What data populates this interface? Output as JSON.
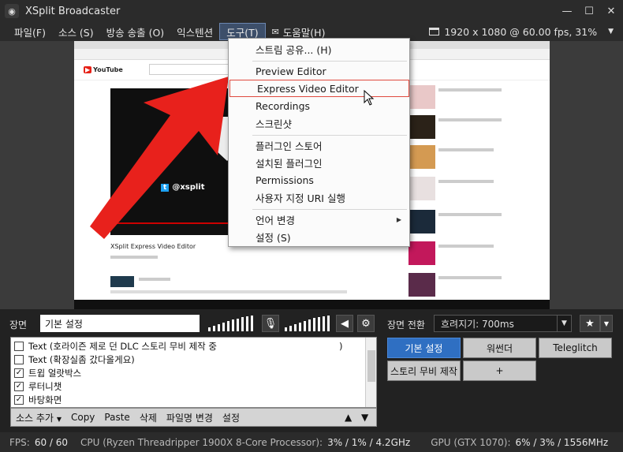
{
  "window": {
    "title": "XSplit Broadcaster",
    "icon": "broadcast-icon",
    "controls": [
      "minimize-icon",
      "maximize-icon",
      "close-icon"
    ]
  },
  "menubar": {
    "items": [
      {
        "label": "파일(F)"
      },
      {
        "label": "소스 (S)"
      },
      {
        "label": "방송 송출 (O)"
      },
      {
        "label": "익스텐션"
      },
      {
        "label": "도구(T)"
      },
      {
        "label": "도움말(H)"
      }
    ],
    "resolution": "1920 x 1080 @ 60.00 fps, 31%"
  },
  "tools_menu": {
    "items": [
      {
        "label": "스트림 공유... (H)"
      },
      {
        "label": "Preview Editor"
      },
      {
        "label": "Express Video Editor"
      },
      {
        "label": "Recordings"
      },
      {
        "label": "스크린샷"
      },
      {
        "label": "플러그인 스토어"
      },
      {
        "label": "설치된 플러그인"
      },
      {
        "label": "Permissions"
      },
      {
        "label": "사용자 지정 URI 실행"
      },
      {
        "label": "언어 변경"
      },
      {
        "label": "설정 (S)"
      }
    ],
    "highlighted": "Express Video Editor"
  },
  "preview": {
    "site": "YouTube",
    "video_handle": "@xsplit",
    "video_title": "XSplit Express Video Editor",
    "twitter_badge": "t"
  },
  "scene_panel": {
    "label": "장면",
    "current_scene": "기본 설정"
  },
  "sources": {
    "items": [
      {
        "label": "Text (호라이즌 제로 던 DLC 스토리 무비 제작 중",
        "suffix": ")",
        "checked": false
      },
      {
        "label": "Text (확장실좀 갔다올게요)",
        "checked": false
      },
      {
        "label": "트윕 얼랏박스",
        "checked": true
      },
      {
        "label": "루터니챗",
        "checked": true
      },
      {
        "label": "바탕화면",
        "checked": true
      }
    ],
    "toolbar": {
      "add": "소스 추가",
      "copy": "Copy",
      "paste": "Paste",
      "delete": "삭제",
      "rename": "파일명 변경",
      "settings": "설정"
    }
  },
  "transition": {
    "label": "장면 전환",
    "value": "흐려지기: 700ms"
  },
  "scenes": [
    {
      "label": "기본 설정",
      "active": true
    },
    {
      "label": "워썬더",
      "active": false
    },
    {
      "label": "Teleglitch",
      "active": false
    },
    {
      "label": "스토리 무비 제작",
      "active": false
    },
    {
      "label": "+",
      "active": false
    }
  ],
  "status": {
    "fps_label": "FPS:",
    "fps_value": "60 / 60",
    "cpu_label": "CPU (Ryzen Threadripper 1900X 8-Core Processor):",
    "cpu_value": "3% / 1% / 4.2GHz",
    "gpu_label": "GPU (GTX 1070):",
    "gpu_value": "6% / 3% / 1556MHz"
  },
  "colors": {
    "accent_blue": "#2f6fc2",
    "arrow_red": "#e8211c",
    "highlight_border": "#e04a3f"
  }
}
